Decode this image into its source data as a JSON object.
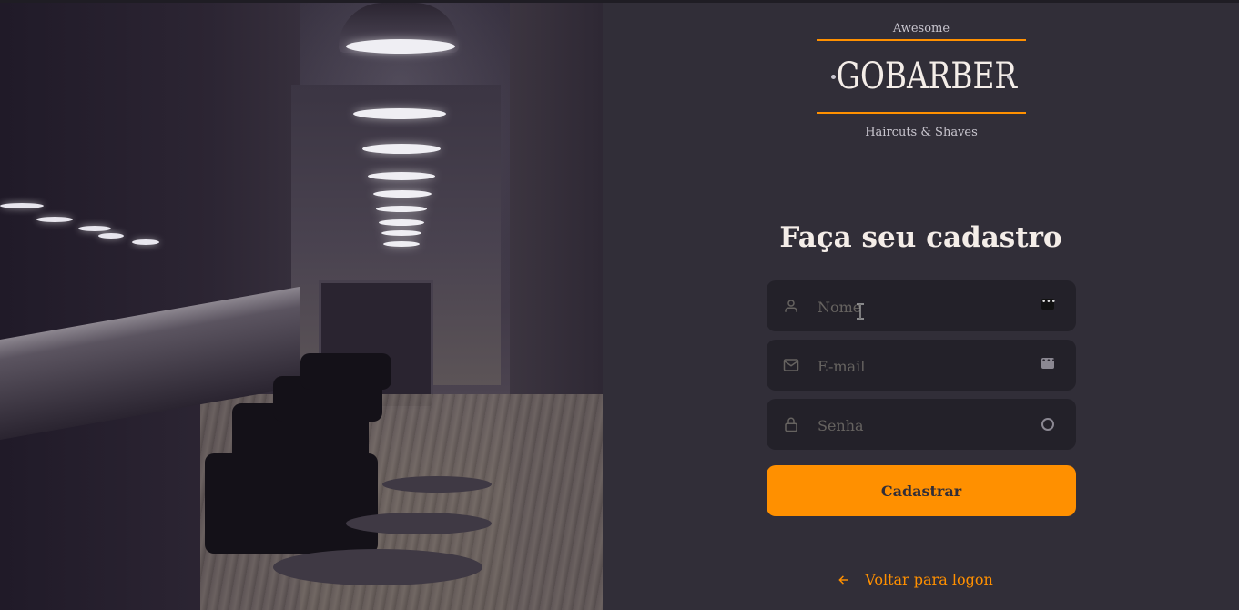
{
  "colors": {
    "background": "#312e38",
    "input_background": "#232129",
    "accent": "#ff9000",
    "text": "#f4ede8",
    "placeholder": "#666360"
  },
  "hero": {
    "description_icon": "barbershop-photo"
  },
  "logo": {
    "top_text": "Awesome",
    "title": "GOBARBER",
    "bottom_text": "Haircuts & Shaves"
  },
  "form": {
    "heading": "Faça seu cadastro",
    "fields": {
      "name": {
        "placeholder": "Nome",
        "value": "",
        "icon": "user-icon"
      },
      "email": {
        "placeholder": "E-mail",
        "value": "",
        "icon": "mail-icon"
      },
      "password": {
        "placeholder": "Senha",
        "value": "",
        "icon": "lock-icon"
      }
    },
    "submit_label": "Cadastrar"
  },
  "back_link": {
    "label": "Voltar para logon",
    "icon": "arrow-left-icon"
  }
}
